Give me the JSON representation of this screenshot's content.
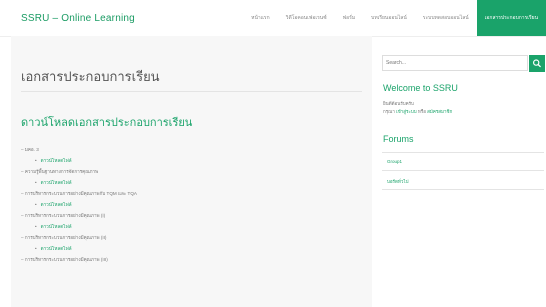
{
  "header": {
    "brand": "SSRU – Online Learning",
    "nav": [
      {
        "label": "หน้าแรก"
      },
      {
        "label": "วิดีโอคอนเฟอเรนซ์"
      },
      {
        "label": "ฟอรั่ม"
      },
      {
        "label": "บทเรียนออนไลน์"
      },
      {
        "label": "ระบบทดสอบออนไลน์"
      },
      {
        "label": "เอกสารประกอบการเรียน",
        "active": true
      }
    ]
  },
  "main": {
    "page_title": "เอกสารประกอบการเรียน",
    "section_title": "ดาวน์โหลดเอกสารประกอบการเรียน",
    "items": [
      {
        "type": "category",
        "text": "– มคอ. 3"
      },
      {
        "type": "link",
        "text": "ดาวน์โหลดไฟล์"
      },
      {
        "type": "category",
        "text": "– ความรู้พื้นฐานทางการจัดการคุณภาพ"
      },
      {
        "type": "link",
        "text": "ดาวน์โหลดไฟล์"
      },
      {
        "type": "category",
        "text": "– การบริหารกระบวนการอย่างมีคุณภาพกับ TQM และ TQA"
      },
      {
        "type": "link",
        "text": "ดาวน์โหลดไฟล์"
      },
      {
        "type": "category",
        "text": "– การบริหารกระบวนการอย่างมีคุณภาพ (I)"
      },
      {
        "type": "link",
        "text": "ดาวน์โหลดไฟล์"
      },
      {
        "type": "category",
        "text": "– การบริหารกระบวนการอย่างมีคุณภาพ (II)"
      },
      {
        "type": "link",
        "text": "ดาวน์โหลดไฟล์"
      },
      {
        "type": "category",
        "text": "– การบริหารกระบวนการอย่างมีคุณภาพ (III)"
      }
    ]
  },
  "sidebar": {
    "search_placeholder": "Search...",
    "search_icon": "search-icon",
    "welcome_title": "Welcome to SSRU",
    "welcome_line1": "ยินดีต้อนรับครับ",
    "welcome_prefix": "กรุณา",
    "login_link": "เข้าสู่ระบบ",
    "welcome_or": "หรือ",
    "register_link": "สมัครสมาชิก",
    "forums_title": "Forums",
    "forums": [
      {
        "label": "Group1"
      },
      {
        "label": "บอร์ดทั่วไป"
      }
    ]
  },
  "colors": {
    "accent": "#1aa36a",
    "content_bg": "#f7f7f7",
    "text": "#555555"
  }
}
